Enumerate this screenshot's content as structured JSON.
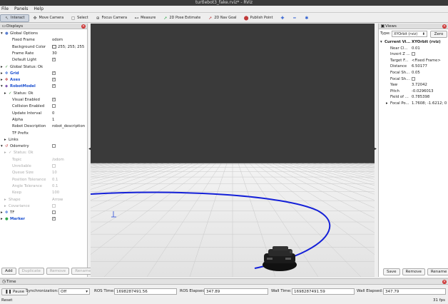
{
  "window": {
    "title": "turtlebot3_fake.rviz* - RViz"
  },
  "menu": [
    "File",
    "Panels",
    "Help"
  ],
  "toolbar": [
    {
      "label": "Interact",
      "icon": "cursor-icon",
      "glyph": "↖",
      "active": true
    },
    {
      "label": "Move Camera",
      "icon": "move-camera-icon",
      "glyph": "✥"
    },
    {
      "label": "Select",
      "icon": "select-icon",
      "glyph": "▢"
    },
    {
      "label": "Focus Camera",
      "icon": "focus-camera-icon",
      "glyph": "⊕"
    },
    {
      "label": "Measure",
      "icon": "measure-icon",
      "glyph": "⊷"
    },
    {
      "label": "2D Pose Estimate",
      "icon": "pose-estimate-icon",
      "glyph": "➚"
    },
    {
      "label": "2D Nav Goal",
      "icon": "nav-goal-icon",
      "glyph": "➚"
    },
    {
      "label": "Publish Point",
      "icon": "publish-point-icon",
      "glyph": "⬤"
    },
    {
      "label": "",
      "icon": "plus-icon",
      "glyph": "✚"
    },
    {
      "label": "",
      "icon": "minus-icon",
      "glyph": "━"
    },
    {
      "label": "",
      "icon": "settings-icon",
      "glyph": "✱"
    }
  ],
  "displays": {
    "title": "Displays",
    "rows": [
      {
        "name": "Global Options",
        "level": 0,
        "arrow": "▾",
        "icon": "●",
        "iconColor": "#5a7fd0"
      },
      {
        "name": "Fixed Frame",
        "value": "odom",
        "level": 2
      },
      {
        "name": "Background Color",
        "value": "255; 255; 255",
        "level": 2,
        "swatch": true
      },
      {
        "name": "Frame Rate",
        "value": "30",
        "level": 2
      },
      {
        "name": "Default Light",
        "level": 2,
        "check": true
      },
      {
        "name": "Global Status: Ok",
        "level": 0,
        "arrow": "▸",
        "icon": "✓"
      },
      {
        "name": "Grid",
        "level": 0,
        "arrow": "▸",
        "icon": "✥",
        "iconColor": "#3b6ed6",
        "blue": true,
        "check": true
      },
      {
        "name": "Axes",
        "level": 0,
        "arrow": "▸",
        "icon": "✥",
        "iconColor": "#c03a3a",
        "blue": true,
        "check": true
      },
      {
        "name": "RobotModel",
        "level": 0,
        "arrow": "▾",
        "icon": "◆",
        "iconColor": "#7a4fb0",
        "blue": true,
        "check": true
      },
      {
        "name": "Status: Ok",
        "level": 1,
        "arrow": "▸",
        "icon": "✓"
      },
      {
        "name": "Visual Enabled",
        "level": 2,
        "check": true
      },
      {
        "name": "Collision Enabled",
        "level": 2,
        "check": false
      },
      {
        "name": "Update Interval",
        "value": "0",
        "level": 2
      },
      {
        "name": "Alpha",
        "value": "1",
        "level": 2
      },
      {
        "name": "Robot Description",
        "value": "robot_description",
        "level": 2
      },
      {
        "name": "TF Prefix",
        "level": 2
      },
      {
        "name": "Links",
        "level": 1,
        "arrow": "▸"
      },
      {
        "name": "Odometry",
        "level": 0,
        "arrow": "▾",
        "icon": "↺",
        "iconColor": "#c03a3a",
        "check": false
      },
      {
        "name": "Status: Ok",
        "level": 1,
        "arrow": "▸",
        "icon": "✓",
        "dim": true
      },
      {
        "name": "Topic",
        "value": "/odom",
        "level": 2,
        "dim": true
      },
      {
        "name": "Unreliable",
        "level": 2,
        "dim": true,
        "check": false
      },
      {
        "name": "Queue Size",
        "value": "10",
        "level": 2,
        "dim": true
      },
      {
        "name": "Position Tolerance",
        "value": "0.1",
        "level": 2,
        "dim": true
      },
      {
        "name": "Angle Tolerance",
        "value": "0.1",
        "level": 2,
        "dim": true
      },
      {
        "name": "Keep",
        "value": "100",
        "level": 2,
        "dim": true
      },
      {
        "name": "Shape",
        "value": "Arrow",
        "level": 1,
        "arrow": "▸",
        "dim": true
      },
      {
        "name": "Covariance",
        "level": 1,
        "arrow": "▸",
        "dim": true,
        "check": false
      },
      {
        "name": "TF",
        "level": 0,
        "arrow": "▸",
        "icon": "✥",
        "iconColor": "#3b6ed6",
        "check": false
      },
      {
        "name": "Marker",
        "level": 0,
        "arrow": "▸",
        "icon": "●",
        "iconColor": "#2fa84a",
        "blue": true,
        "check": true
      }
    ],
    "buttons": [
      {
        "label": "Add",
        "enabled": true
      },
      {
        "label": "Duplicate",
        "enabled": false
      },
      {
        "label": "Remove",
        "enabled": false
      },
      {
        "label": "Rename",
        "enabled": false
      }
    ]
  },
  "views": {
    "title": "Views",
    "type_label": "Type:",
    "type_value": "XYOrbit (rviz)",
    "zero_label": "Zero",
    "current_label": "Current Vi...",
    "current_value": "XYOrbit (rviz)",
    "props": [
      {
        "name": "Near Cl...",
        "value": "0.01"
      },
      {
        "name": "Invert Z ...",
        "check": false
      },
      {
        "name": "Target F...",
        "value": "<Fixed Frame>"
      },
      {
        "name": "Distance",
        "value": "6.50177"
      },
      {
        "name": "Focal Sh...",
        "value": "0.05"
      },
      {
        "name": "Focal Sh...",
        "check": false
      },
      {
        "name": "Yaw",
        "value": "3.72042"
      },
      {
        "name": "Pitch",
        "value": "-0.0296013"
      },
      {
        "name": "Field of ...",
        "value": "0.785398"
      },
      {
        "name": "Focal Po...",
        "value": "1.7608; -1.6212; 0",
        "arrow": true
      }
    ],
    "buttons": [
      "Save",
      "Remove",
      "Rename"
    ]
  },
  "time": {
    "title": "Time",
    "pause_label": "Pause",
    "sync_label": "Synchronization:",
    "sync_value": "Off",
    "ros_time_label": "ROS Time:",
    "ros_time": "1698287491.56",
    "ros_elapsed_label": "ROS Elapsed:",
    "ros_elapsed": "347.89",
    "wall_time_label": "Wall Time:",
    "wall_time": "1698287491.59",
    "wall_elapsed_label": "Wall Elapsed:",
    "wall_elapsed": "347.79"
  },
  "status": {
    "reset_label": "Reset",
    "fps": "31 fps"
  },
  "colors": {
    "accent": "#1a4fd0",
    "path": "#1420d8",
    "viewport_bg": "#3a3a3a",
    "grid_floor": "#f2f2f2"
  }
}
